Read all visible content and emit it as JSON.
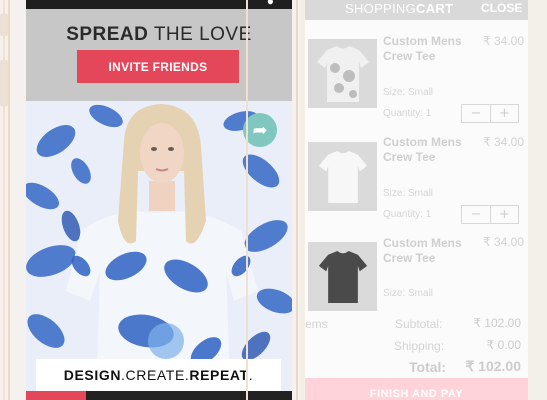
{
  "left_screen": {
    "banner": {
      "title_bold": "SPREAD",
      "title_light": "THE LOVE",
      "invite_button": "INVITE FRIENDS"
    },
    "tagline": {
      "part1": "DESIGN",
      "part2": "CREATE",
      "part3": "REPEAT"
    },
    "icons": [
      "share-arrow-icon"
    ],
    "colors": {
      "invite_button": "#e5475a",
      "share_circle": "#7fc7bf",
      "banner_bg": "#c7c7c7"
    }
  },
  "cart": {
    "title_light": "SHOPPING",
    "title_bold": "CART",
    "close_label": "CLOSE",
    "items": [
      {
        "name": "Custom Mens Crew Tee",
        "price": "₹ 34.00",
        "size": "Size: Small",
        "quantity": "Quantity: 1"
      },
      {
        "name": "Custom Mens Crew Tee",
        "price": "₹ 34.00",
        "size": "Size: Small",
        "quantity": "Quantity: 1"
      },
      {
        "name": "Custom Mens Crew Tee",
        "price": "₹ 34.00",
        "size": "Size: Small"
      }
    ],
    "stepper": {
      "minus": "−",
      "plus": "+"
    },
    "items_label_partial": "ems",
    "subtotal_label": "Subtotal:",
    "subtotal_value": "₹ 102.00",
    "shipping_label": "Shipping:",
    "shipping_value": "₹ 0.00",
    "total_label": "Total:",
    "total_value": "₹ 102.00",
    "finish_button": "FINISH AND PAY",
    "colors": {
      "finish_button": "#ffd3d9"
    }
  }
}
